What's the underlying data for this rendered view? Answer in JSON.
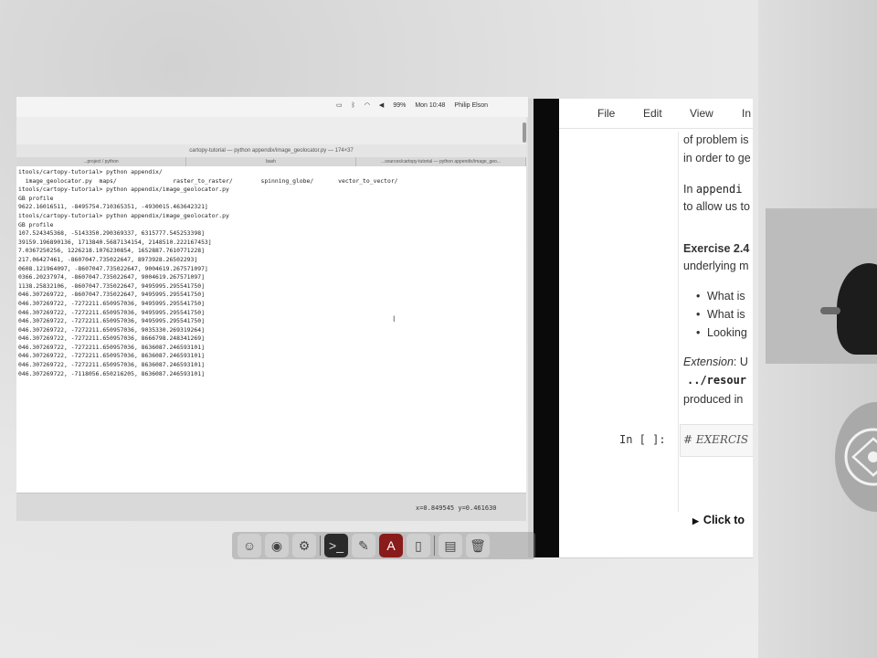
{
  "menubar": {
    "battery": "99%",
    "clock": "Mon 10:48",
    "user": "Philip Elson"
  },
  "terminal": {
    "title": "cartopy-tutorial — python appendix/image_geolocator.py — 174×37",
    "tabs": [
      "...project / python",
      "bash",
      "...sources/cartopy-tutorial — python appendix/image_geo..."
    ],
    "lines": [
      "itools/cartopy-tutorial> python appendix/",
      "  image_geolocator.py  maps/                raster_to_raster/        spinning_globe/       vector_to_vector/",
      "itools/cartopy-tutorial> python appendix/image_geolocator.py",
      "GB profile",
      "9622.16016511, -8495754.710365351, -4930015.463642321]",
      "itools/cartopy-tutorial> python appendix/image_geolocator.py",
      "GB profile",
      "107.524345368, -5143350.290369337, 6315777.545253398]",
      "39159.196890136, 1713840.5687134154, 2148510.222167453]",
      "7.0367250256, 1226218.1076230854, 1652887.7610771228]",
      "217.06427461, -8607047.735022647, 8973928.26502293]",
      "0608.121964097, -8607047.735022647, 9004619.267571097]",
      "0366.20237974, -8607047.735022647, 9004619.267571097]",
      "1138.25832106, -8607047.735022647, 9495995.295541750]",
      "046.307269722, -8607047.735022647, 9495995.295541750]",
      "046.307269722, -7272211.650957036, 9495995.295541750]",
      "046.307269722, -7272211.650957036, 9495995.295541750]",
      "046.307269722, -7272211.650957036, 9495995.295541750]",
      "046.307269722, -7272211.650957036, 9035330.269319264]",
      "046.307269722, -7272211.650957036, 8666798.248341269]",
      "046.307269722, -7272211.650957036, 8636087.246593101]",
      "046.307269722, -7272211.650957036, 8636087.246593101]",
      "046.307269722, -7272211.650957036, 8636087.246593101]",
      "046.307269722, -7118056.650216205, 8636087.246593101]"
    ],
    "coords": "x=0.849545    y=0.461630"
  },
  "dock": {
    "apps": [
      "finder-icon",
      "chrome-icon",
      "system-preferences-icon",
      "terminal-icon",
      "textedit-icon",
      "acrobat-icon",
      "document-icon",
      "downloads-folder-icon",
      "trash-icon"
    ]
  },
  "jupyter": {
    "menu": [
      "File",
      "Edit",
      "View",
      "In"
    ],
    "p1_line1": "of problem is",
    "p1_line2": "in order to ge",
    "p2_prefix": "In ",
    "p2_code": "appendi",
    "p2_line2": "to allow us to",
    "exercise_title": "Exercise 2.4",
    "exercise_line2": "underlying m",
    "bullets": [
      "What is",
      "What is",
      "Looking"
    ],
    "ext_label": "Extension",
    "ext_rest": ": U",
    "ext_code": "../resour",
    "ext_line3": "produced in",
    "in_prompt": "In [ ]:",
    "in_code": "# EXERCIS",
    "click_to": "Click to"
  }
}
